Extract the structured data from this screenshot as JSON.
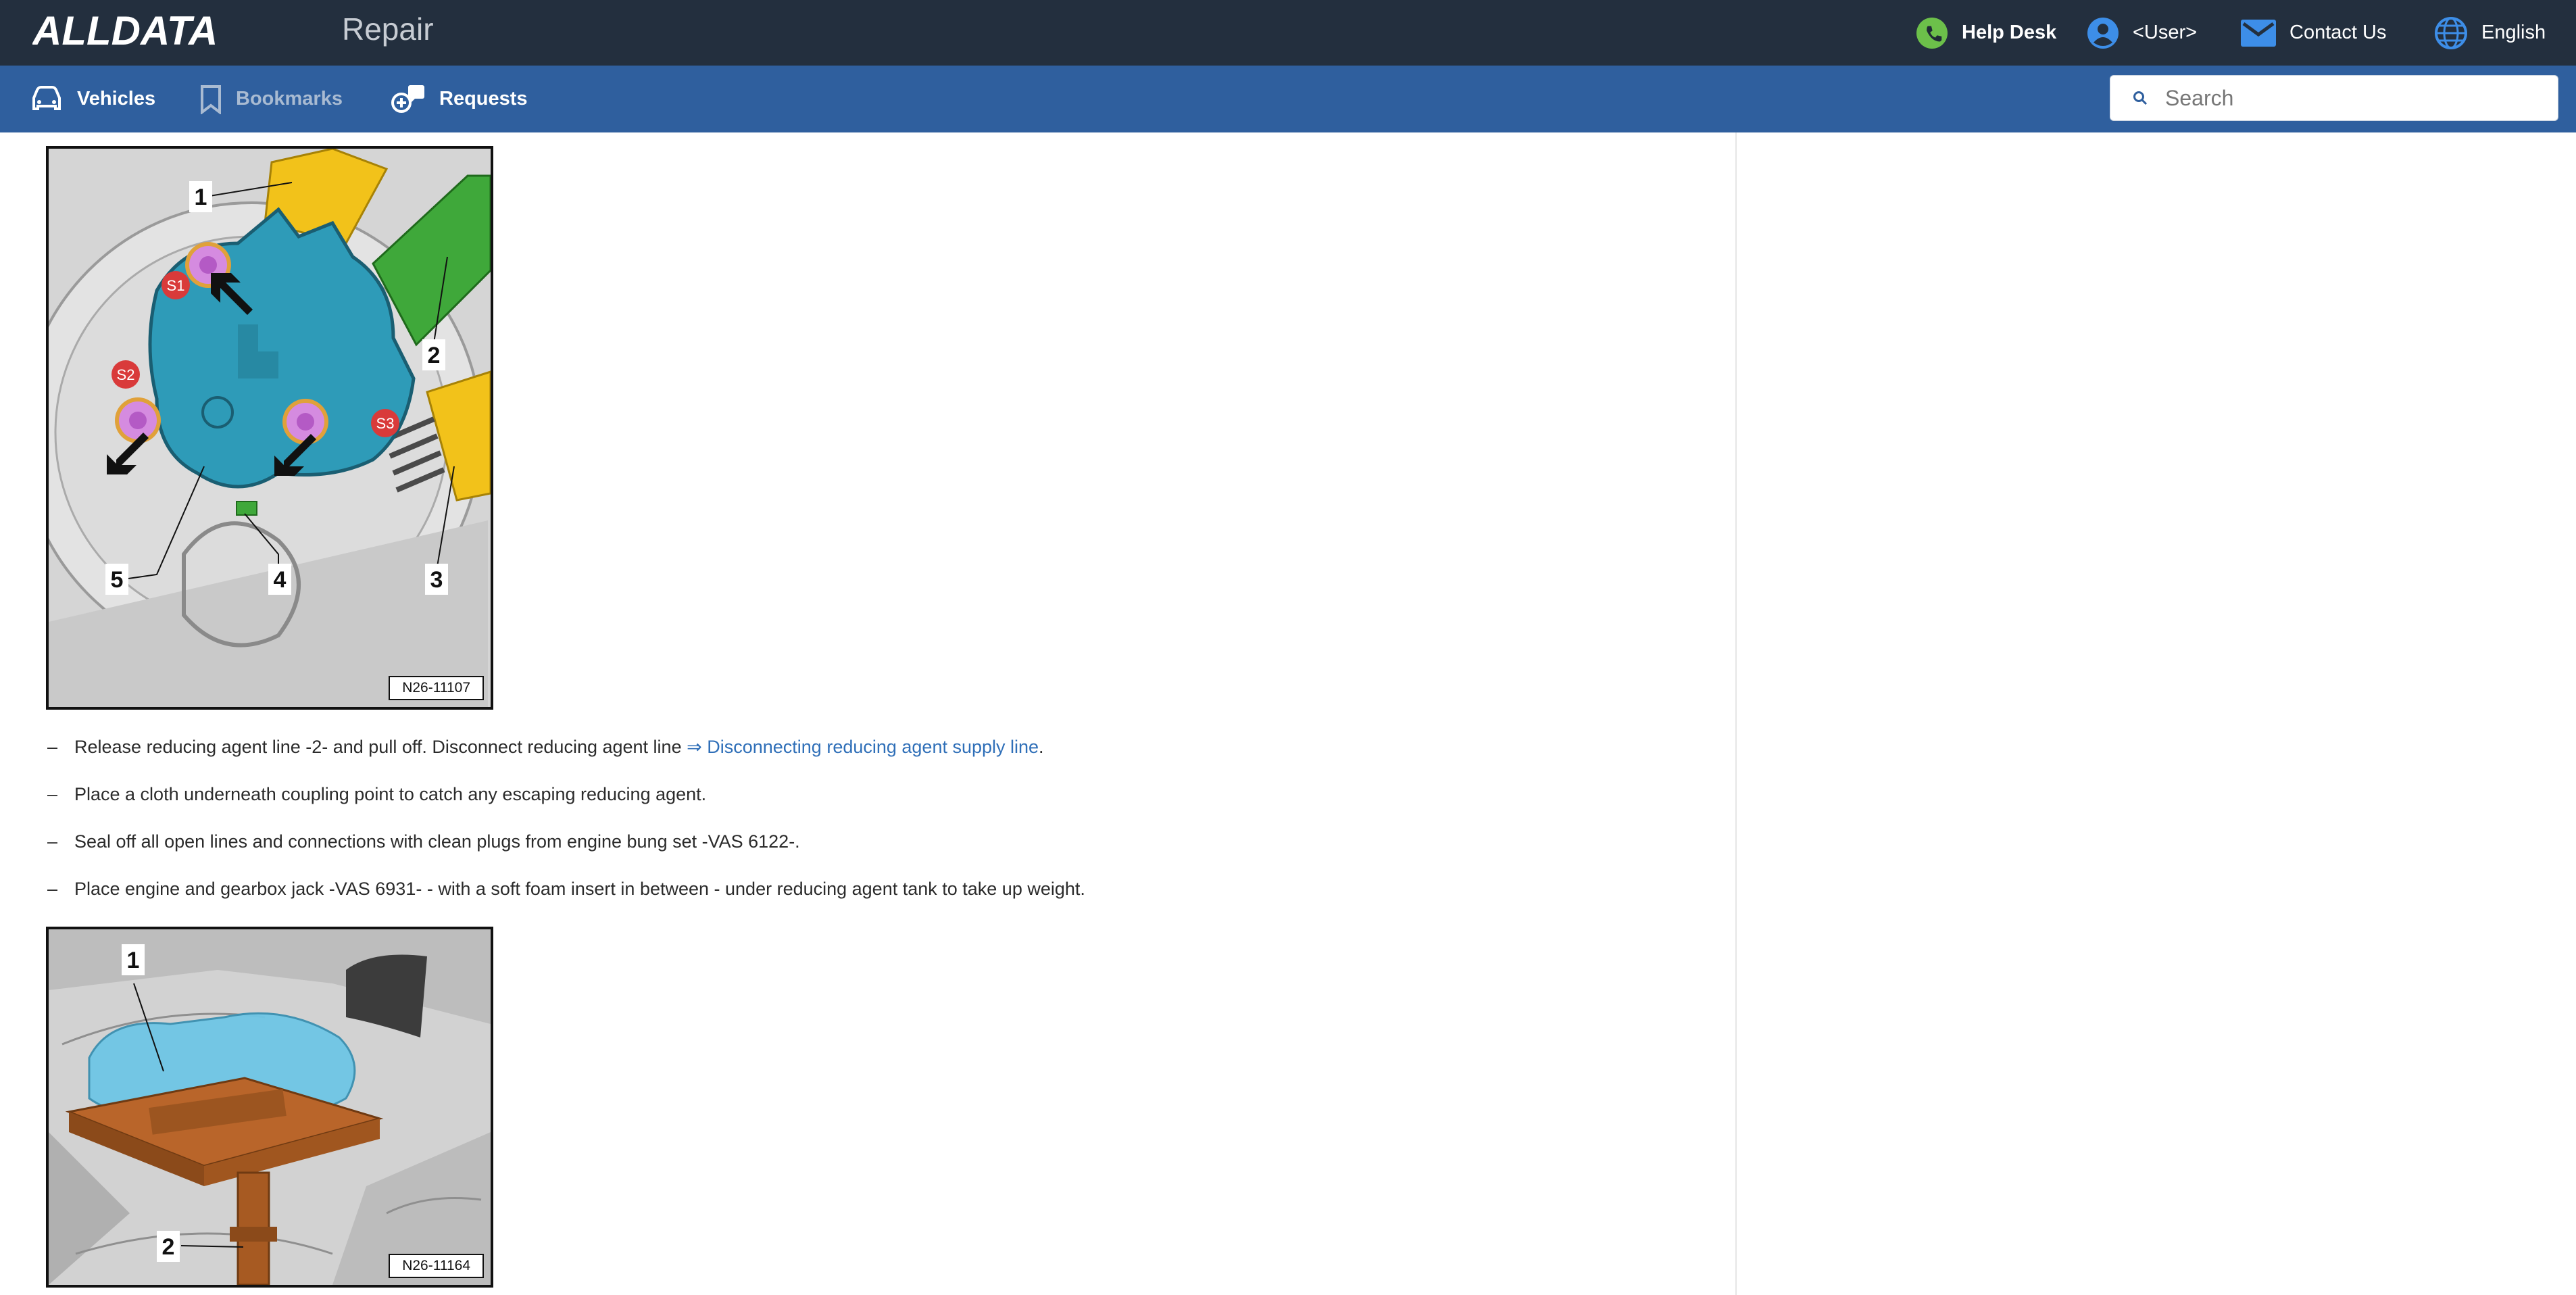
{
  "header": {
    "brand": "ALLDATA",
    "app_name": "Repair",
    "help_desk": "Help Desk",
    "user": "<User>",
    "contact": "Contact Us",
    "language": "English"
  },
  "nav": {
    "vehicles": "Vehicles",
    "bookmarks": "Bookmarks",
    "requests": "Requests"
  },
  "search": {
    "placeholder": "Search"
  },
  "figure1": {
    "code": "N26-11107",
    "callouts": [
      "1",
      "2",
      "3",
      "4",
      "5"
    ],
    "markers": [
      "S1",
      "S2",
      "S3"
    ]
  },
  "steps": [
    {
      "text": "Release reducing agent line -2- and pull off. Disconnect reducing agent line ",
      "link_arrow": "⇒",
      "link": "Disconnecting reducing agent supply line",
      "suffix": "."
    },
    {
      "text": "Place a cloth underneath coupling point to catch any escaping reducing agent."
    },
    {
      "text": "Seal off all open lines and connections with clean plugs from engine bung set -VAS 6122-."
    },
    {
      "text": "Place engine and gearbox jack -VAS 6931- - with a soft foam insert in between - under reducing agent tank to take up weight."
    }
  ],
  "step_bullet": "–",
  "figure2": {
    "code": "N26-11164",
    "callouts": [
      "1",
      "2"
    ]
  },
  "colors": {
    "topbar": "#232f3e",
    "navbar": "#2f5f9e",
    "link": "#2f6fb8",
    "help_icon": "#6cc04a"
  }
}
